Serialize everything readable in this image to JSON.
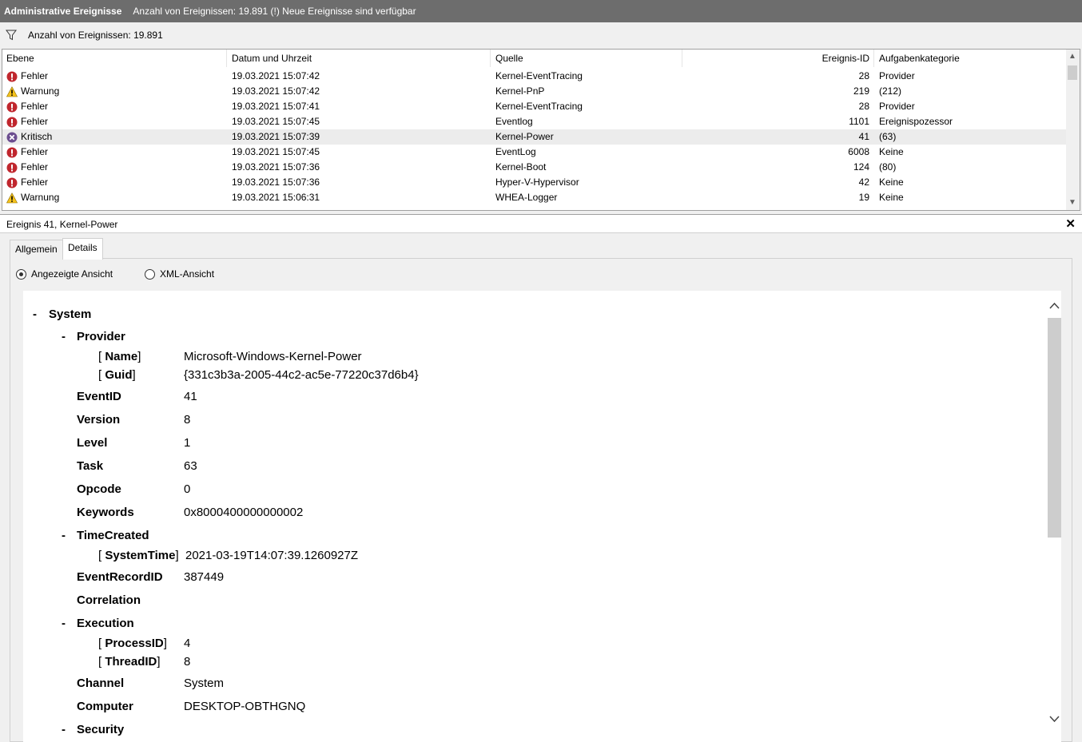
{
  "titlebar": {
    "title": "Administrative Ereignisse",
    "info": "Anzahl von Ereignissen: 19.891 (!) Neue Ereignisse sind verfügbar"
  },
  "filter": {
    "text": "Anzahl von Ereignissen: 19.891",
    "icon": "filter-icon"
  },
  "columns": [
    "Ebene",
    "Datum und Uhrzeit",
    "Quelle",
    "Ereignis-ID",
    "Aufgabenkategorie"
  ],
  "events": [
    {
      "level": "Fehler",
      "icon": "error-icon",
      "date": "19.03.2021 15:07:42",
      "source": "Kernel-EventTracing",
      "id": "28",
      "category": "Provider"
    },
    {
      "level": "Warnung",
      "icon": "warning-icon",
      "date": "19.03.2021 15:07:42",
      "source": "Kernel-PnP",
      "id": "219",
      "category": "(212)"
    },
    {
      "level": "Fehler",
      "icon": "error-icon",
      "date": "19.03.2021 15:07:41",
      "source": "Kernel-EventTracing",
      "id": "28",
      "category": "Provider"
    },
    {
      "level": "Fehler",
      "icon": "error-icon",
      "date": "19.03.2021 15:07:45",
      "source": "Eventlog",
      "id": "1101",
      "category": "Ereignispozessor"
    },
    {
      "level": "Kritisch",
      "icon": "critical-icon",
      "date": "19.03.2021 15:07:39",
      "source": "Kernel-Power",
      "id": "41",
      "category": "(63)",
      "selected": true
    },
    {
      "level": "Fehler",
      "icon": "error-icon",
      "date": "19.03.2021 15:07:45",
      "source": "EventLog",
      "id": "6008",
      "category": "Keine"
    },
    {
      "level": "Fehler",
      "icon": "error-icon",
      "date": "19.03.2021 15:07:36",
      "source": "Kernel-Boot",
      "id": "124",
      "category": "(80)"
    },
    {
      "level": "Fehler",
      "icon": "error-icon",
      "date": "19.03.2021 15:07:36",
      "source": "Hyper-V-Hypervisor",
      "id": "42",
      "category": "Keine"
    },
    {
      "level": "Warnung",
      "icon": "warning-icon",
      "date": "19.03.2021 15:06:31",
      "source": "WHEA-Logger",
      "id": "19",
      "category": "Keine"
    }
  ],
  "detail": {
    "title": "Ereignis 41, Kernel-Power",
    "close": "✕",
    "tabs": [
      "Allgemein",
      "Details"
    ],
    "radio_friendly": "Angezeigte Ansicht",
    "radio_xml": "XML-Ansicht",
    "xml": {
      "system": "System",
      "provider": "Provider",
      "name_key": "Name",
      "name_val": "Microsoft-Windows-Kernel-Power",
      "guid_key": "Guid",
      "guid_val": "{331c3b3a-2005-44c2-ac5e-77220c37d6b4}",
      "eventid_key": "EventID",
      "eventid_val": "41",
      "version_key": "Version",
      "version_val": "8",
      "level_key": "Level",
      "level_val": "1",
      "task_key": "Task",
      "task_val": "63",
      "opcode_key": "Opcode",
      "opcode_val": "0",
      "keywords_key": "Keywords",
      "keywords_val": "0x8000400000000002",
      "timecreated": "TimeCreated",
      "systemtime_key": "SystemTime",
      "systemtime_val": "2021-03-19T14:07:39.1260927Z",
      "recordid_key": "EventRecordID",
      "recordid_val": "387449",
      "correlation": "Correlation",
      "execution": "Execution",
      "processid_key": "ProcessID",
      "processid_val": "4",
      "threadid_key": "ThreadID",
      "threadid_val": "8",
      "channel_key": "Channel",
      "channel_val": "System",
      "computer_key": "Computer",
      "computer_val": "DESKTOP-OBTHGNQ",
      "security": "Security",
      "collapse": "-",
      "lb": "[",
      "rb": "]"
    }
  }
}
